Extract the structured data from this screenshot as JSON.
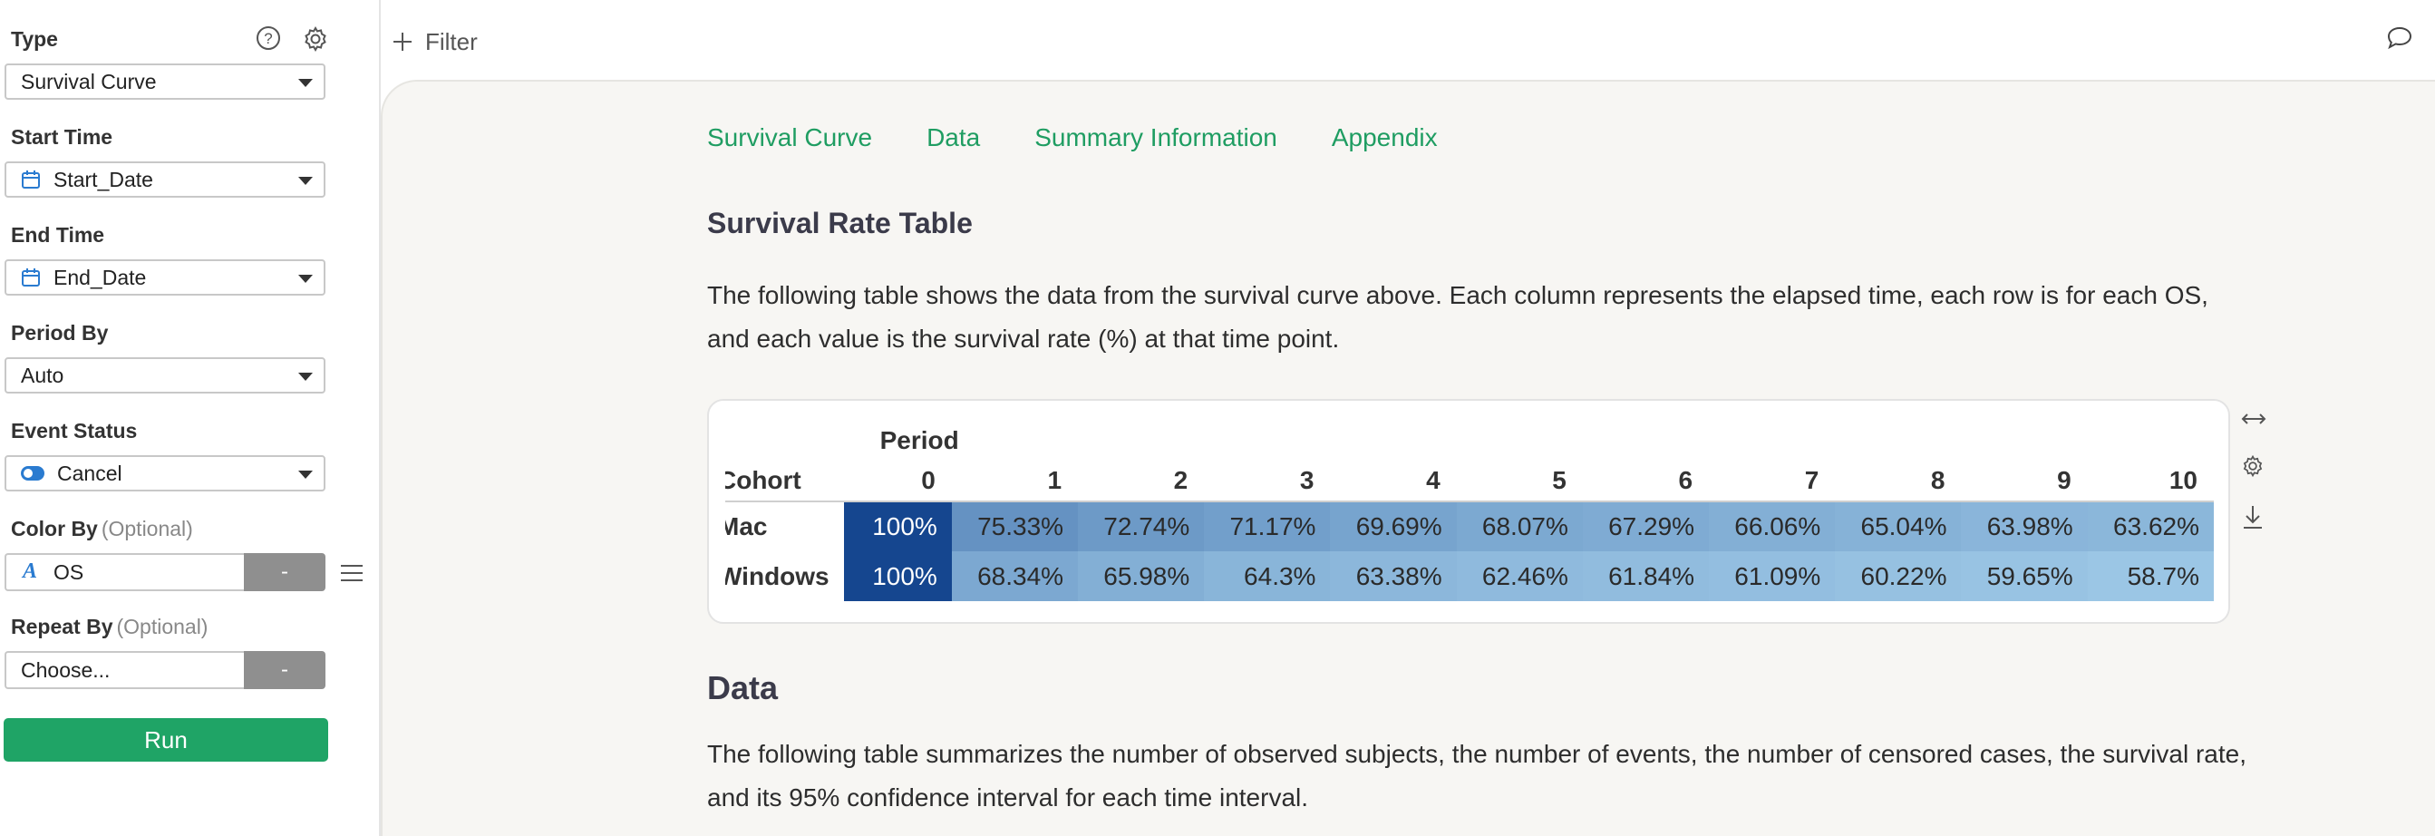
{
  "sidebar": {
    "type": {
      "label": "Type",
      "value": "Survival Curve"
    },
    "start_time": {
      "label": "Start Time",
      "value": "Start_Date"
    },
    "end_time": {
      "label": "End Time",
      "value": "End_Date"
    },
    "period_by": {
      "label": "Period By",
      "value": "Auto"
    },
    "event_status": {
      "label": "Event Status",
      "value": "Cancel"
    },
    "color_by": {
      "label": "Color By",
      "optional": "(Optional)",
      "value": "OS",
      "button": "-"
    },
    "repeat_by": {
      "label": "Repeat By",
      "optional": "(Optional)",
      "value": "Choose...",
      "button": "-"
    },
    "run": "Run"
  },
  "topbar": {
    "filter": "Filter"
  },
  "tabs": [
    "Survival Curve",
    "Data",
    "Summary Information",
    "Appendix"
  ],
  "survival_section": {
    "title": "Survival Rate Table",
    "description": "The following table shows the data from the survival curve above. Each column represents the elapsed time, each row is for each OS, and each value is the survival rate (%) at that time point.",
    "table": {
      "group_header": "Period",
      "row_header": "Cohort",
      "columns": [
        "0",
        "1",
        "2",
        "3",
        "4",
        "5",
        "6",
        "7",
        "8",
        "9",
        "10"
      ],
      "rows": [
        {
          "name": "Mac",
          "values": [
            "100%",
            "75.33%",
            "72.74%",
            "71.17%",
            "69.69%",
            "68.07%",
            "67.29%",
            "66.06%",
            "65.04%",
            "63.98%",
            "63.62%"
          ]
        },
        {
          "name": "Windows",
          "values": [
            "100%",
            "68.34%",
            "65.98%",
            "64.3%",
            "63.38%",
            "62.46%",
            "61.84%",
            "61.09%",
            "60.22%",
            "59.65%",
            "58.7%"
          ]
        }
      ]
    }
  },
  "data_section": {
    "title": "Data",
    "description": "The following table summarizes the number of observed subjects, the number of events, the number of censored cases, the survival rate, and its 95% confidence interval for each time interval."
  },
  "colors": {
    "accent_green": "#1fa466",
    "tab_green": "#1f9d62",
    "heat_dark": "#15468f",
    "heat_mid": "#5d9ed0",
    "heat_light": "#9dc8e6"
  }
}
